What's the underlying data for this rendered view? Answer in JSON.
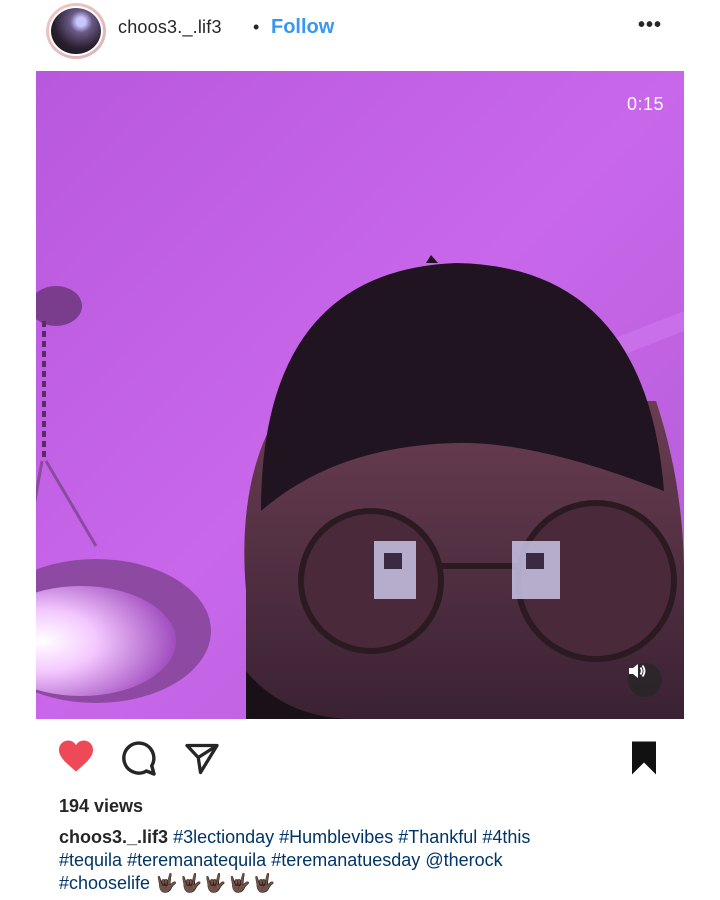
{
  "post": {
    "username": "choos3._.lif3",
    "separator": "•",
    "follow_label": "Follow",
    "more_label": "•••",
    "video_timer": "0:15",
    "views": "194 views"
  },
  "caption": {
    "username": "choos3._.lif3",
    "hashtags_line1": [
      "#3lectionday",
      "#Humblevibes",
      "#Thankful",
      "#4this"
    ],
    "hashtags_line2": [
      "#tequila",
      "#teremanatequila",
      "#teremanatuesday"
    ],
    "mention": "@therock",
    "hashtag_last": "#chooselife",
    "emoji": "🤟🏿🤟🏿🤟🏿🤟🏿🤟🏿"
  },
  "icons": {
    "like": "heart-icon",
    "comment": "comment-icon",
    "share": "share-icon",
    "save": "bookmark-icon",
    "sound": "speaker-icon"
  },
  "colors": {
    "like_red": "#ed4956",
    "follow_blue": "#3897f0",
    "hashtag_blue": "#003569",
    "video_purple": "#c15fe0"
  }
}
